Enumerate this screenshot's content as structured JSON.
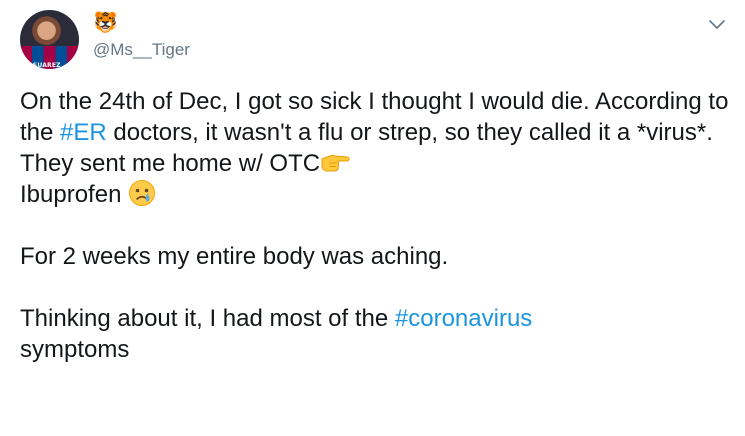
{
  "author": {
    "display_name": "🐯",
    "handle": "@Ms__Tiger",
    "avatar_caption": "S SUAREZ"
  },
  "icons": {
    "menu": "chevron-down-icon",
    "pointing_emoji": "backhand-index-pointing-right-emoji",
    "crying_emoji": "crying-face-emoji"
  },
  "colors": {
    "text": "#14171a",
    "handle": "#657786",
    "hashtag": "#1b95e0"
  },
  "tweet": {
    "p1_part1": "On the 24th of Dec, I got so sick I thought I would die. According to the ",
    "hashtag_er": "#ER",
    "p1_part2": " doctors, it wasn't a flu or strep, so they called it a *virus*. They sent me home w/ OTC",
    "p1_part3": "Ibuprofen ",
    "p2": "For 2 weeks my entire body was aching.",
    "p3_part1": "Thinking about it, I had most of the ",
    "hashtag_coronavirus": "#coronavirus",
    "p3_part2": " symptoms"
  }
}
